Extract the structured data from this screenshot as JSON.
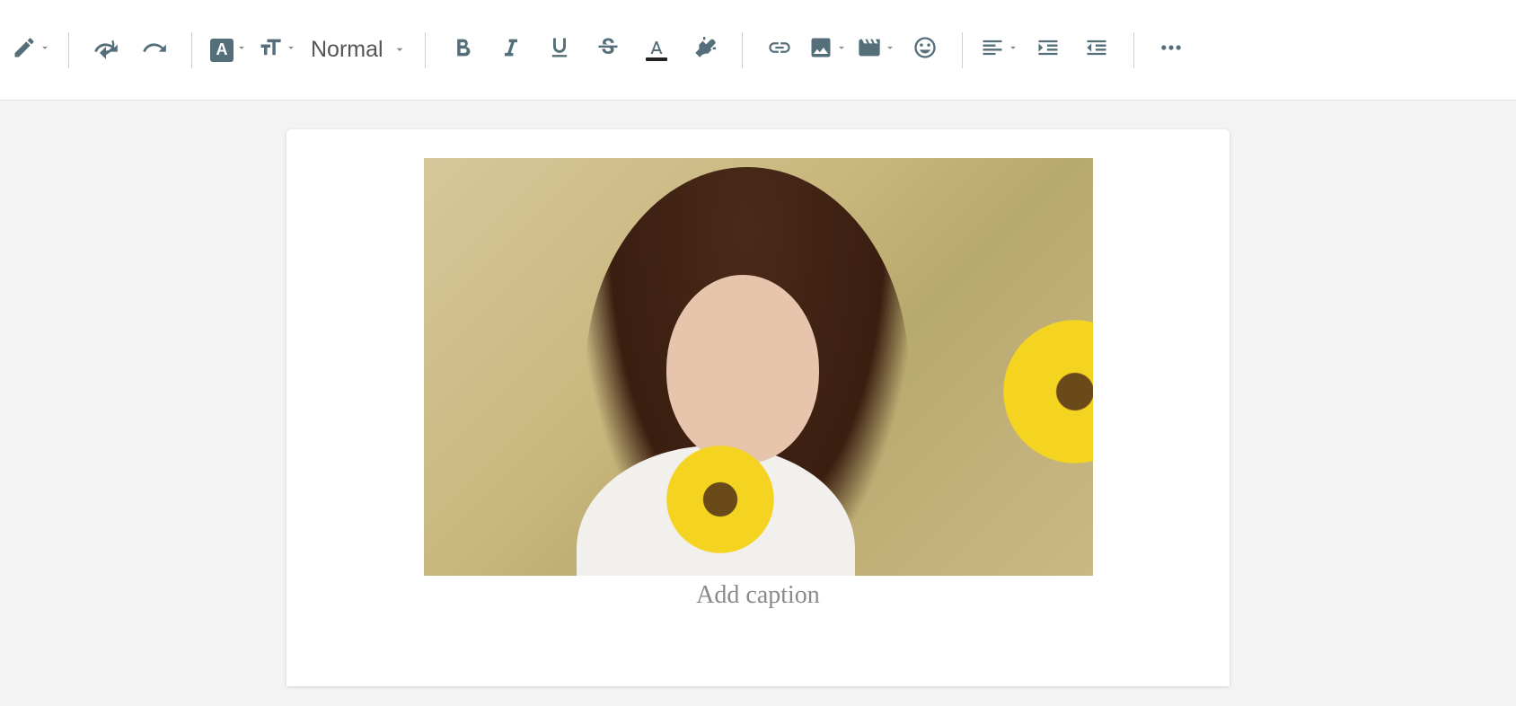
{
  "toolbar": {
    "format_label": "Normal",
    "icons": {
      "edit_mode": "edit-mode-icon",
      "undo": "undo-icon",
      "redo": "redo-icon",
      "font_family": "font-family-icon",
      "font_size": "font-size-icon",
      "bold": "bold-icon",
      "italic": "italic-icon",
      "underline": "underline-icon",
      "strikethrough": "strikethrough-icon",
      "font_color": "font-color-icon",
      "highlight": "highlight-icon",
      "link": "link-icon",
      "image": "image-icon",
      "video": "video-icon",
      "emoji": "emoji-icon",
      "align": "align-icon",
      "indent": "indent-icon",
      "outdent": "outdent-icon",
      "more": "more-icon"
    }
  },
  "editor": {
    "image_alt": "Photo of a young woman with long brown hair holding a sunflower, sitting in hay",
    "caption_placeholder": "Add caption"
  }
}
